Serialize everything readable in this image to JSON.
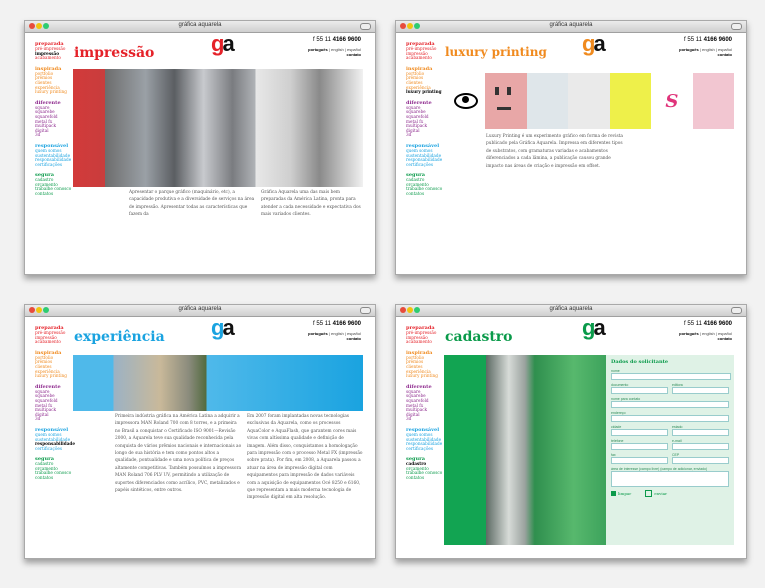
{
  "window_title": "gráfica aquarela",
  "logo": {
    "g": "g",
    "a": "a"
  },
  "header": {
    "phone_prefix": "f 55 11",
    "phone_number": "4166 9600",
    "lang_pt": "português",
    "lang_en": "english",
    "lang_es": "español",
    "separator": "|",
    "contact": "contato"
  },
  "colors": {
    "preparada": "#e52229",
    "inspirada": "#f08a1e",
    "diferente": "#8e2b8e",
    "responsavel": "#1aa3e0",
    "segura": "#0a9a4a"
  },
  "sidebar": [
    {
      "head": "preparada",
      "items": [
        "pré-impressão",
        "impressão",
        "acabamento"
      ]
    },
    {
      "head": "inspirada",
      "items": [
        "portfolio",
        "prêmios",
        "clientes",
        "experiência",
        "luxury printing"
      ]
    },
    {
      "head": "diferente",
      "items": [
        "square",
        "squarebe",
        "squarefold",
        "metal fx",
        "multipack",
        "digital",
        "3d"
      ]
    },
    {
      "head": "responsável",
      "items": [
        "quem somos",
        "sustentabilidade",
        "responsabilidade",
        "certificações"
      ]
    },
    {
      "head": "segura",
      "items": [
        "cadastro",
        "orçamento",
        "trabalhe conosco",
        "contatos"
      ]
    }
  ],
  "windows": [
    {
      "title": "impressão",
      "col1": "Apresentar o parque gráfico (maquinário, etc), a capacidade produtiva e a diversidade de serviços na área de impressão. Apresentar todas as características que fazem da",
      "col2": "Gráfica Aquarela uma das mais bem preparadas da América Latina, pronta para atender a cada necessidade e expectativa dos mais variados clientes."
    },
    {
      "title": "luxury printing",
      "col1": "Luxury Printing é um experimento gráfico em forma de revista publicado pela Gráfica Aquarela. Impressa em diferentes tipos de substratos, com gramaturas variadas e acabamentos diferenciados a cada lâmina, a publicação causou grande impacto nas áreas de criação e impressão em offset."
    },
    {
      "title": "experiência",
      "col1": "Primeira indústria gráfica na América Latina a adquirir a impressora MAN Roland 700 com 8 torres, e a primeira no Brasil a conquistar o Certificado ISO 9001—Revisão 2000, a Aquarela teve sua qualidade reconhecida pela conquista de vários prêmios nacionais e internacionais ao longo de sua história e tem como pontos altos a qualidade, pontualidade e uma nova política de preços altamente competitivas. Também possuímos a impressora MAN Roland 706 PLV UV, permitindo a utilização de suportes diferenciados como acrílico, PVC, metalizados e papéis sintéticos, entre outros.",
      "col2": "Em 2007 foram implantadas novas tecnologias exclusivas da Aquarela, como os processos AquaColor e AquaFlash, que garantem cores mais vivas com altíssima qualidade e definição de imagem. Além disso, conquistamos a homologação para impressão com o processo Metal FX (impressão sobre prata). Por fim, em 2008, a Aquarela passou a atuar na área de impressão digital com equipamentos para impressão de dados variáveis com a aquisição de equipamentos Océ 8250 e 6160, que representam a mais moderna tecnologia de impressão digital em alta resolução."
    },
    {
      "title": "cadastro",
      "form_title": "Dados do solicitante",
      "labels": [
        "nome",
        "documento",
        "editora",
        "nome para contato",
        "endereço",
        "cidade",
        "estado",
        "telefone",
        "e-mail",
        "fax",
        "CEP",
        "área de interesse (campo livre) (campo de adicionar, enviado)"
      ],
      "btn_send": "limpar",
      "btn_clear": "enviar"
    }
  ]
}
